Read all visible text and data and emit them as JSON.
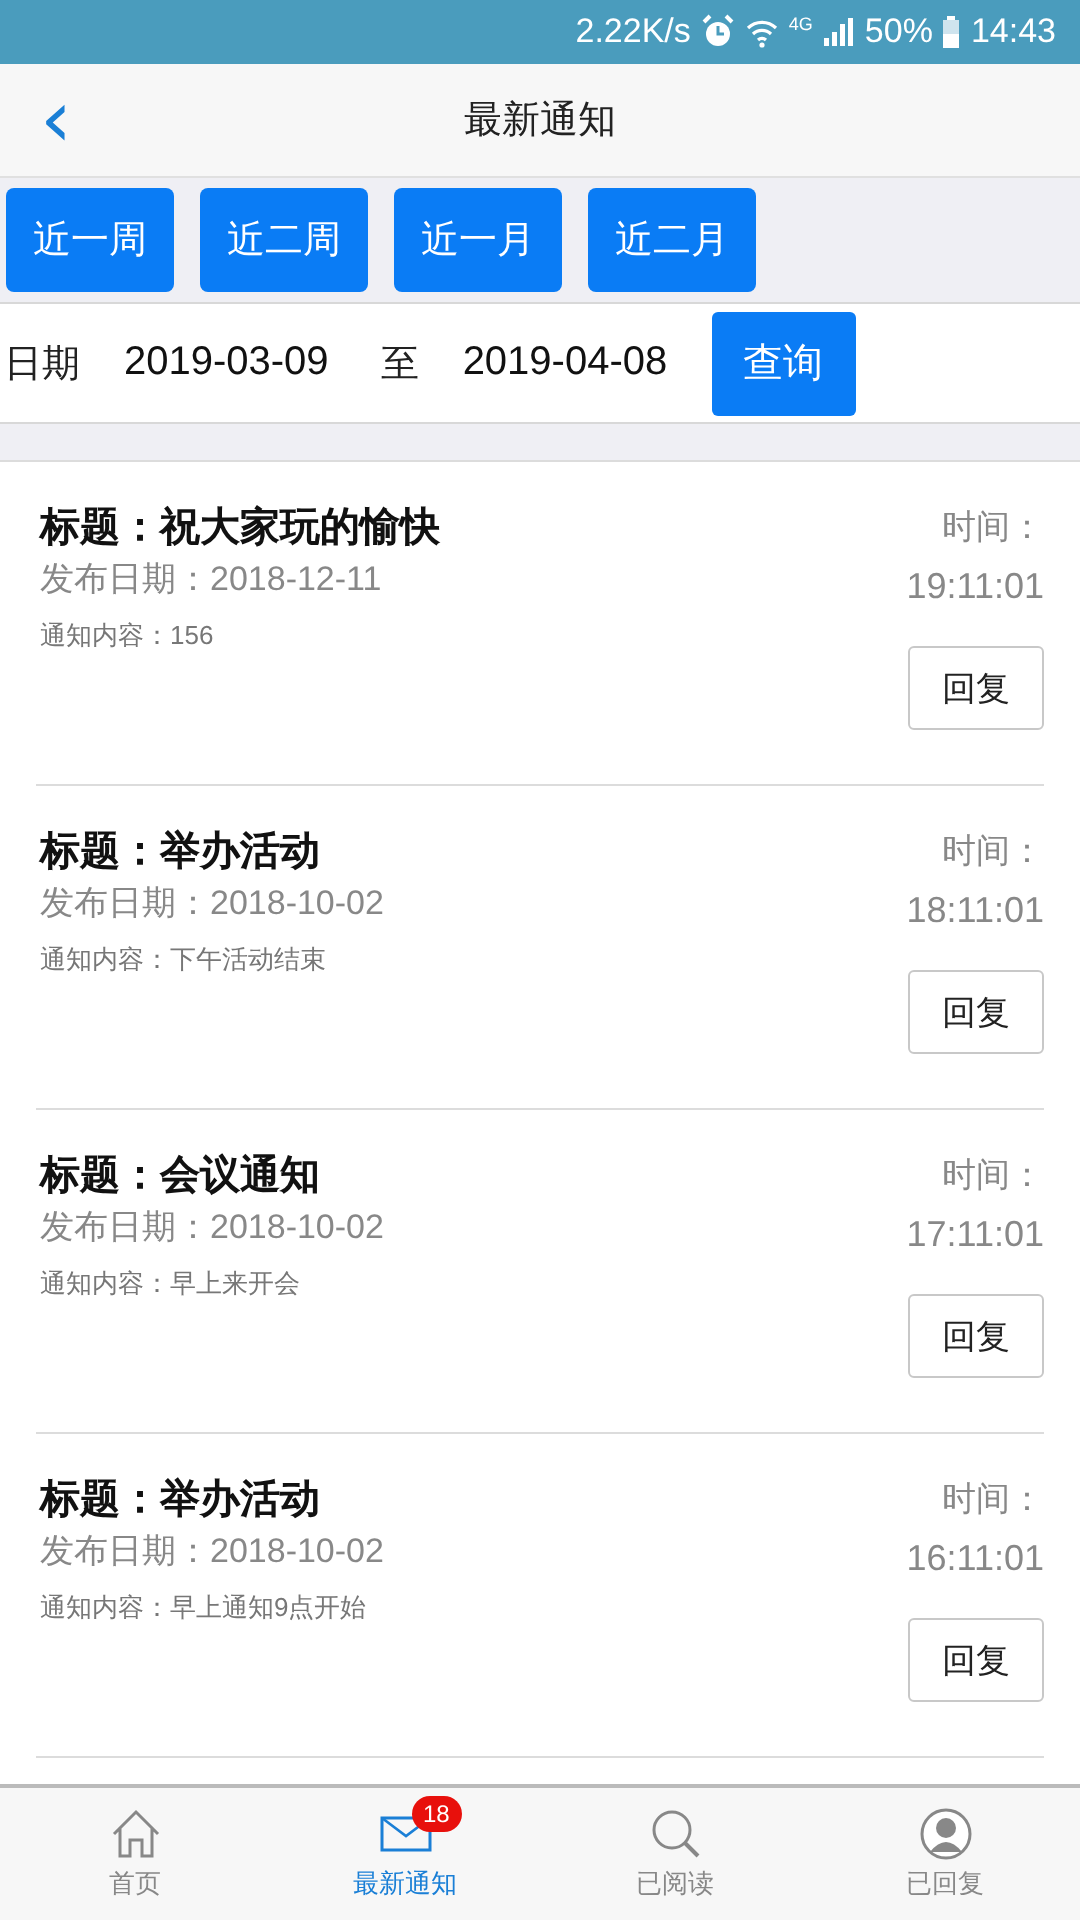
{
  "status_bar": {
    "speed": "2.22K/s",
    "network": "4G",
    "battery": "50%",
    "time": "14:43"
  },
  "header": {
    "back": "‹",
    "title": "最新通知"
  },
  "range_buttons": [
    "近一周",
    "近二周",
    "近一月",
    "近二月"
  ],
  "date_filter": {
    "label": "日期",
    "from": "2019-03-09",
    "separator": "至",
    "to": "2019-04-08",
    "query_button": "查询"
  },
  "notices": [
    {
      "title": "标题：祝大家玩的愉快",
      "date": "发布日期：2018-12-11",
      "content": "通知内容：156",
      "time_label": "时间：",
      "time": "19:11:01",
      "reply": "回复"
    },
    {
      "title": "标题：举办活动",
      "date": "发布日期：2018-10-02",
      "content": "通知内容：下午活动结束",
      "time_label": "时间：",
      "time": "18:11:01",
      "reply": "回复"
    },
    {
      "title": "标题：会议通知",
      "date": "发布日期：2018-10-02",
      "content": "通知内容：早上来开会",
      "time_label": "时间：",
      "time": "17:11:01",
      "reply": "回复"
    },
    {
      "title": "标题：举办活动",
      "date": "发布日期：2018-10-02",
      "content": "通知内容：早上通知9点开始",
      "time_label": "时间：",
      "time": "16:11:01",
      "reply": "回复"
    }
  ],
  "tab_bar": [
    {
      "kind": "home",
      "label": "首页",
      "selected": false
    },
    {
      "kind": "mail",
      "label": "最新通知",
      "selected": true,
      "badge": "18"
    },
    {
      "kind": "search",
      "label": "已阅读",
      "selected": false
    },
    {
      "kind": "person",
      "label": "已回复",
      "selected": false
    }
  ]
}
